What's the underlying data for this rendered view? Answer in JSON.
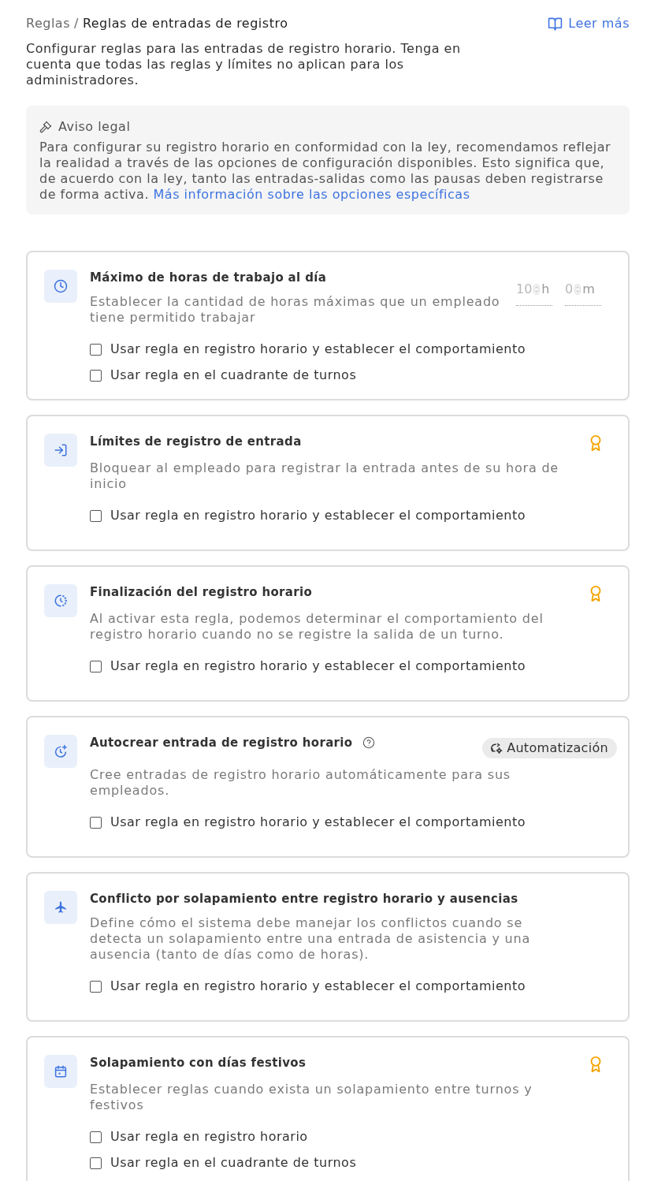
{
  "breadcrumb": {
    "items": [
      {
        "label": "Reglas",
        "current": false
      },
      {
        "label": "Reglas de entradas de registro",
        "current": true
      }
    ],
    "separator": "/"
  },
  "read_more": {
    "label": "Leer más"
  },
  "intro": "Configurar reglas para las entradas de registro horario. Tenga en cuenta que todas las reglas y límites no aplican para los administradores.",
  "legal": {
    "title": "Aviso legal",
    "text": "Para configurar su registro horario en conformidad con la ley, recomendamos reflejar la realidad a través de las opciones de configuración disponibles. Esto significa que, de acuerdo con la ley, tanto las entradas-salidas como las pausas deben registrarse de forma activa.",
    "link": "Más información sobre las opciones específicas"
  },
  "rules": [
    {
      "title": "Máximo de horas de trabajo al día",
      "description": "Establecer la cantidad de horas máximas que un empleado tiene permitido trabajar",
      "duration": [
        {
          "value": "10",
          "unit": "h"
        },
        {
          "value": "0",
          "unit": "m"
        }
      ],
      "options": [
        {
          "label": "Usar regla en registro horario y establecer el comportamiento",
          "checked": false
        },
        {
          "label": "Usar regla en el cuadrante de turnos",
          "checked": false
        }
      ]
    },
    {
      "title": "Límites de registro de entrada",
      "description": "Bloquear al empleado para registrar la entrada antes de su hora de inicio",
      "premium": true,
      "options": [
        {
          "label": "Usar regla en registro horario y establecer el comportamiento",
          "checked": false
        }
      ]
    },
    {
      "title": "Finalización del registro horario",
      "description": "Al activar esta regla, podemos determinar el comportamiento del registro horario cuando no se registre la salida de un turno.",
      "premium": true,
      "options": [
        {
          "label": "Usar regla en registro horario y establecer el comportamiento",
          "checked": false
        }
      ]
    },
    {
      "title": "Autocrear entrada de registro horario",
      "help": true,
      "tag": {
        "label": "Automatización"
      },
      "description": "Cree entradas de registro horario automáticamente para sus empleados.",
      "options": [
        {
          "label": "Usar regla en registro horario y establecer el comportamiento",
          "checked": false
        }
      ]
    },
    {
      "title": "Conflicto por solapamiento entre registro horario y ausencias",
      "description": "Define cómo el sistema debe manejar los conflictos cuando se detecta un solapamiento entre una entrada de asistencia y una ausencia (tanto de días como de horas).",
      "options": [
        {
          "label": "Usar regla en registro horario y establecer el comportamiento",
          "checked": false
        }
      ]
    },
    {
      "title": "Solapamiento con días festivos",
      "description": "Establecer reglas cuando exista un solapamiento entre turnos y festivos",
      "premium": true,
      "options": [
        {
          "label": "Usar regla en registro horario",
          "checked": false
        },
        {
          "label": "Usar regla en el cuadrante de turnos",
          "checked": false
        }
      ]
    }
  ]
}
